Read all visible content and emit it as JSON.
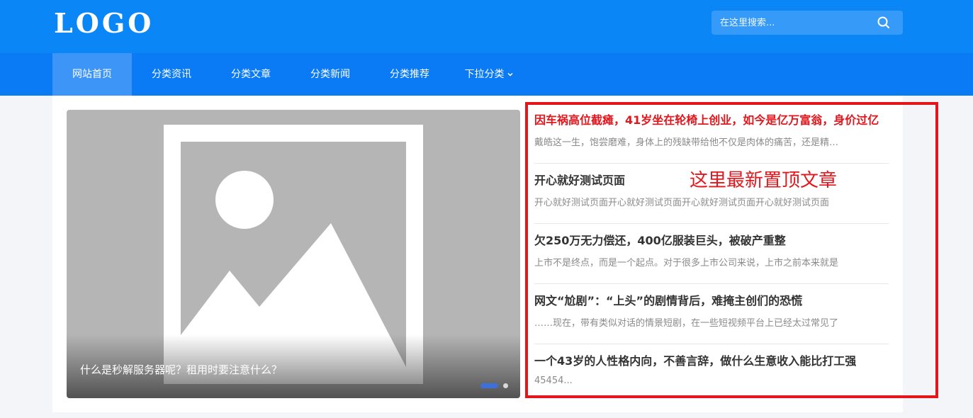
{
  "colors": {
    "header_bg": "#0a86f7",
    "nav_bg": "#0a7af5",
    "nav_active_bg": "#3d95f8",
    "highlight_red": "#e3161c",
    "dot_active": "#3f6fd8"
  },
  "header": {
    "logo_text": "LOGO",
    "search": {
      "placeholder": "在这里搜索...",
      "button_icon": "search-icon"
    }
  },
  "nav": {
    "items": [
      {
        "label": "网站首页",
        "active": true
      },
      {
        "label": "分类资讯",
        "active": false
      },
      {
        "label": "分类文章",
        "active": false
      },
      {
        "label": "分类新闻",
        "active": false
      },
      {
        "label": "分类推荐",
        "active": false
      },
      {
        "label": "下拉分类",
        "active": false,
        "icon": "chevron-down-icon"
      }
    ]
  },
  "slider": {
    "image_icon": "image-placeholder-icon",
    "caption": "什么是秒解服务器呢？租用时要注意什么？",
    "slide_count": 2,
    "active_slide": 1
  },
  "news": {
    "items": [
      {
        "title": "因车祸高位截瘫，41岁坐在轮椅上创业，如今是亿万富翁，身价过亿",
        "desc": "戴皓这一生，饱尝磨难，身体上的残缺带给他不仅是肉体的痛苦，还是精神的折磨",
        "highlight": true
      },
      {
        "title": "开心就好测试页面",
        "desc": "开心就好测试页面开心就好测试页面开心就好测试页面开心就好测试页面",
        "highlight": false
      },
      {
        "title": "欠250万无力偿还，400亿服装巨头，被破产重整",
        "desc": "上市不是终点，而是一个起点。对于很多上市公司来说，上市之前本来就是",
        "highlight": false
      },
      {
        "title": "网文“尬剧”：“上头”的剧情背后，难掩主创们的恐慌",
        "desc": "……现在，带有类似对话的情景短剧，在一些短视频平台上已经太过常见了",
        "highlight": false
      },
      {
        "title": "一个43岁的人性格内向，不善言辞，做什么生意收入能比打工强",
        "desc": "45454...",
        "highlight": false
      }
    ]
  },
  "annotation": {
    "text": "这里最新置顶文章"
  }
}
